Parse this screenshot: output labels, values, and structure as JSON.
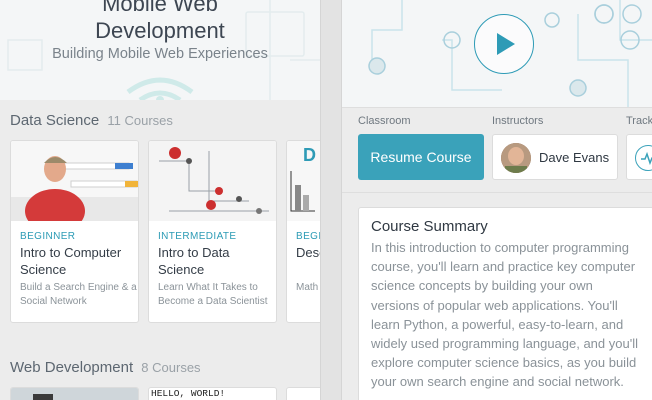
{
  "hero": {
    "title_line1": "Mobile Web",
    "title_line2": "Development",
    "subtitle": "Building Mobile Web Experiences"
  },
  "sections": [
    {
      "title": "Data Science",
      "count": "11 Courses",
      "cards": [
        {
          "level": "BEGINNER",
          "title": "Intro to Computer Science",
          "desc": "Build a Search Engine & a Social Network"
        },
        {
          "level": "INTERMEDIATE",
          "title": "Intro to Data Science",
          "desc": "Learn What It Takes to Become a Data Scientist"
        },
        {
          "level": "BEGI",
          "title": "Desc Stat",
          "desc": "Math Unde"
        }
      ]
    },
    {
      "title": "Web Development",
      "count": "8 Courses",
      "cards": [
        {
          "thumb_text": ""
        },
        {
          "thumb_text": "HELLO, WORLD!"
        },
        {
          "thumb_text": ""
        }
      ]
    }
  ],
  "course": {
    "classroom_label": "Classroom",
    "instructors_label": "Instructors",
    "track_label": "Track",
    "resume_button": "Resume Course",
    "instructor_name": "Dave Evans",
    "summary_title": "Course Summary",
    "summary_text": "In this introduction to computer programming course, you'll learn and practice key computer science concepts by building your own versions of popular web applications. You'll learn Python, a powerful, easy-to-learn, and widely used programming language, and you'll explore computer science basics, as you build your own search engine and social network."
  },
  "colors": {
    "accent": "#3aa2ba",
    "background": "#ececec",
    "card": "#ffffff"
  },
  "icons": [
    "play-icon",
    "wifi-icon",
    "track-icon"
  ]
}
